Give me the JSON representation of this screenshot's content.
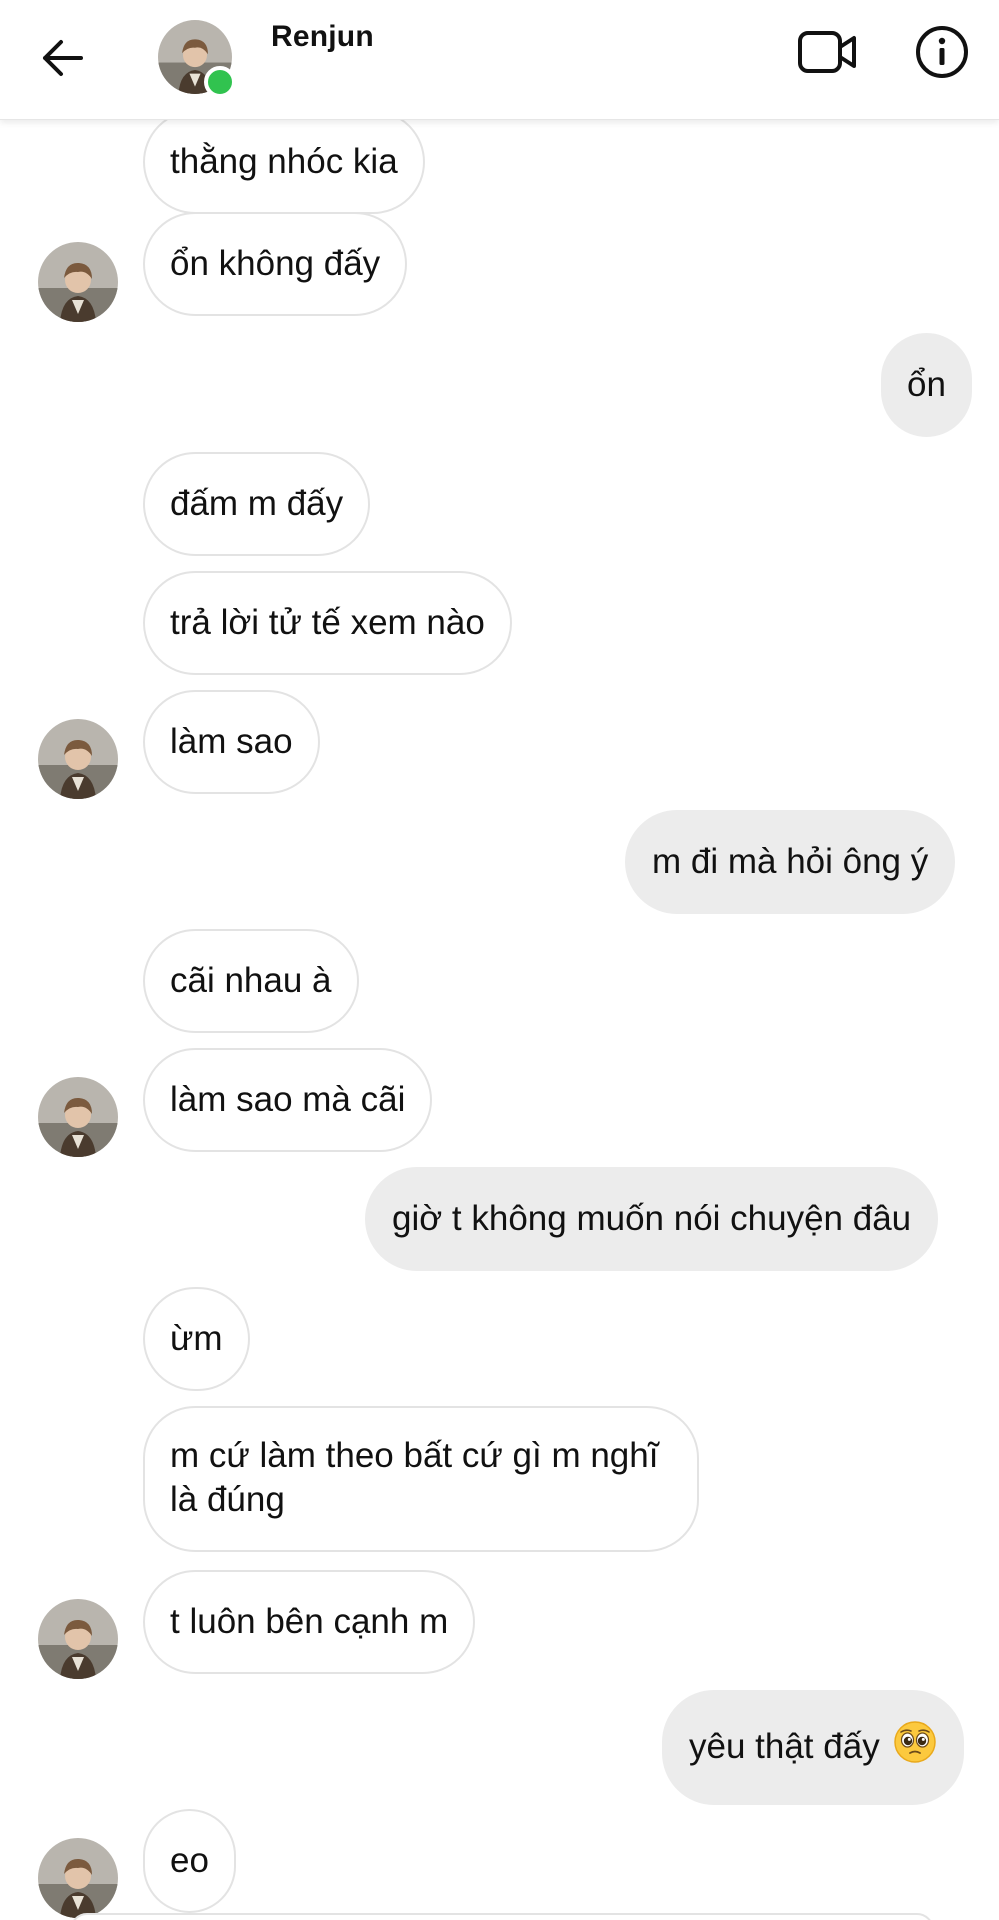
{
  "header": {
    "contact_name": "Renjun",
    "online": true,
    "colors": {
      "online": "#31c34f"
    }
  },
  "icons": {
    "back": "arrow-left-icon",
    "video": "video-camera-icon",
    "info": "info-circle-icon"
  },
  "messages": [
    {
      "side": "in",
      "text": "thằng nhóc kia",
      "avatar": false
    },
    {
      "side": "in",
      "text": "ổn không đấy",
      "avatar": true
    },
    {
      "side": "out",
      "text": "ổn"
    },
    {
      "side": "in",
      "text": "đấm m đấy",
      "avatar": false
    },
    {
      "side": "in",
      "text": "trả lời tử tế xem nào",
      "avatar": false
    },
    {
      "side": "in",
      "text": "làm sao",
      "avatar": true
    },
    {
      "side": "out",
      "text": "m đi mà hỏi ông ý"
    },
    {
      "side": "in",
      "text": "cãi nhau à",
      "avatar": false
    },
    {
      "side": "in",
      "text": "làm sao mà cãi",
      "avatar": true
    },
    {
      "side": "out",
      "text": "giờ t không muốn nói chuyện đâu"
    },
    {
      "side": "in",
      "text": "ừm",
      "avatar": false
    },
    {
      "side": "in",
      "text": "m cứ làm theo bất cứ gì m nghĩ là đúng",
      "avatar": false
    },
    {
      "side": "in",
      "text": "t luôn bên cạnh m",
      "avatar": true
    },
    {
      "side": "out",
      "text": "yêu thật đấy",
      "emoji": "pleading-face"
    },
    {
      "side": "in",
      "text": "eo",
      "avatar": true
    }
  ]
}
